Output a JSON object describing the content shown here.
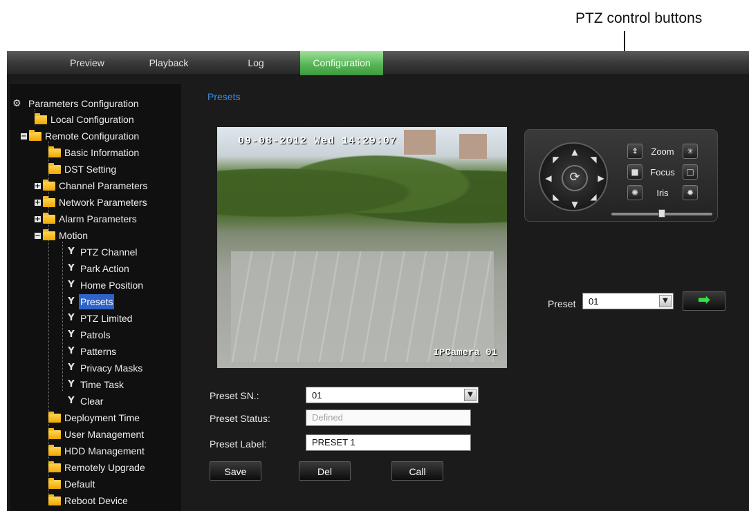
{
  "annotation": {
    "callout_text": "PTZ control buttons"
  },
  "menu": {
    "tabs": [
      {
        "label": "Preview"
      },
      {
        "label": "Playback"
      },
      {
        "label": "Log"
      },
      {
        "label": "Configuration",
        "active": true
      }
    ]
  },
  "tree": {
    "root": "Parameters Configuration",
    "items": [
      {
        "label": "Local Configuration"
      },
      {
        "label": "Remote Configuration"
      },
      {
        "label": "Basic Information"
      },
      {
        "label": "DST Setting"
      },
      {
        "label": "Channel Parameters"
      },
      {
        "label": "Network Parameters"
      },
      {
        "label": "Alarm Parameters"
      },
      {
        "label": "Motion"
      },
      {
        "label": "PTZ Channel"
      },
      {
        "label": "Park Action"
      },
      {
        "label": "Home Position"
      },
      {
        "label": "Presets",
        "selected": true
      },
      {
        "label": "PTZ Limited"
      },
      {
        "label": "Patrols"
      },
      {
        "label": "Patterns"
      },
      {
        "label": "Privacy Masks"
      },
      {
        "label": "Time Task"
      },
      {
        "label": "Clear"
      },
      {
        "label": "Deployment Time"
      },
      {
        "label": "User Management"
      },
      {
        "label": "HDD Management"
      },
      {
        "label": "Remotely Upgrade"
      },
      {
        "label": "Default"
      },
      {
        "label": "Reboot Device"
      }
    ]
  },
  "main": {
    "title": "Presets",
    "video": {
      "osd_time": "09-08-2012 Wed 14:29:07",
      "osd_camera": "IPCamera 01"
    },
    "form": {
      "preset_sn_label": "Preset SN.:",
      "preset_sn_value": "01",
      "preset_status_label": "Preset Status:",
      "preset_status_value": "Defined",
      "preset_label_label": "Preset Label:",
      "preset_label_value": "PRESET 1"
    },
    "buttons": {
      "save": "Save",
      "del": "Del",
      "call": "Call"
    }
  },
  "ptz": {
    "zoom_label": "Zoom",
    "focus_label": "Focus",
    "iris_label": "Iris",
    "speed_level": 0.5,
    "preset_label": "Preset",
    "preset_value": "01",
    "go_color": "#35e04a"
  },
  "colors": {
    "accent_tab": "#58b558",
    "selected_item": "#2f63c8",
    "title_blue": "#3b8fe2"
  }
}
